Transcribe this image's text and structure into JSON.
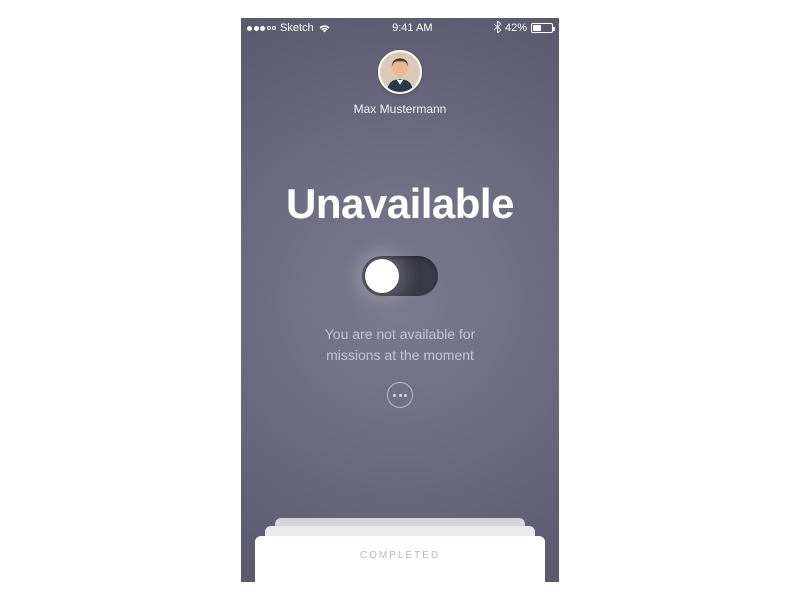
{
  "statusBar": {
    "carrier": "Sketch",
    "time": "9:41 AM",
    "batteryPercent": "42%",
    "batteryLevel": 0.42
  },
  "user": {
    "name": "Max Mustermann"
  },
  "availability": {
    "title": "Unavailable",
    "descriptionLine1": "You are not available for",
    "descriptionLine2": "missions at the moment",
    "toggleState": "off"
  },
  "bottomCard": {
    "label": "COMPLETED"
  }
}
